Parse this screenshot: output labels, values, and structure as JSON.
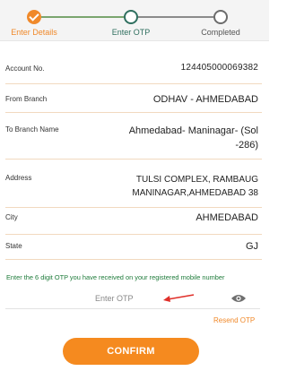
{
  "stepper": {
    "steps": [
      {
        "label": "Enter Details",
        "state": "done"
      },
      {
        "label": "Enter OTP",
        "state": "current"
      },
      {
        "label": "Completed",
        "state": "pending"
      }
    ]
  },
  "details": {
    "account_no": {
      "label": "Account No.",
      "value": "124405000069382"
    },
    "from_branch": {
      "label": "From Branch",
      "value": "ODHAV - AHMEDABAD"
    },
    "to_branch": {
      "label": "To Branch Name",
      "value": "Ahmedabad- Maninagar- (Sol -286)"
    },
    "address": {
      "label": "Address",
      "value": "TULSI COMPLEX, RAMBAUG MANINAGAR,AHMEDABAD 38"
    },
    "city": {
      "label": "City",
      "value": "AHMEDABAD"
    },
    "state": {
      "label": "State",
      "value": "GJ"
    }
  },
  "otp": {
    "instruction": "Enter the 6 digit OTP you have received on your registered mobile number",
    "placeholder": "Enter OTP",
    "value": "",
    "resend_label": "Resend OTP"
  },
  "actions": {
    "confirm_label": "CONFIRM"
  },
  "colors": {
    "accent": "#f58a1f",
    "success": "#1e7b3a",
    "divider": "#f2d9bf"
  },
  "icons": [
    "checkmark-icon",
    "eye-icon",
    "red-arrow-icon"
  ]
}
